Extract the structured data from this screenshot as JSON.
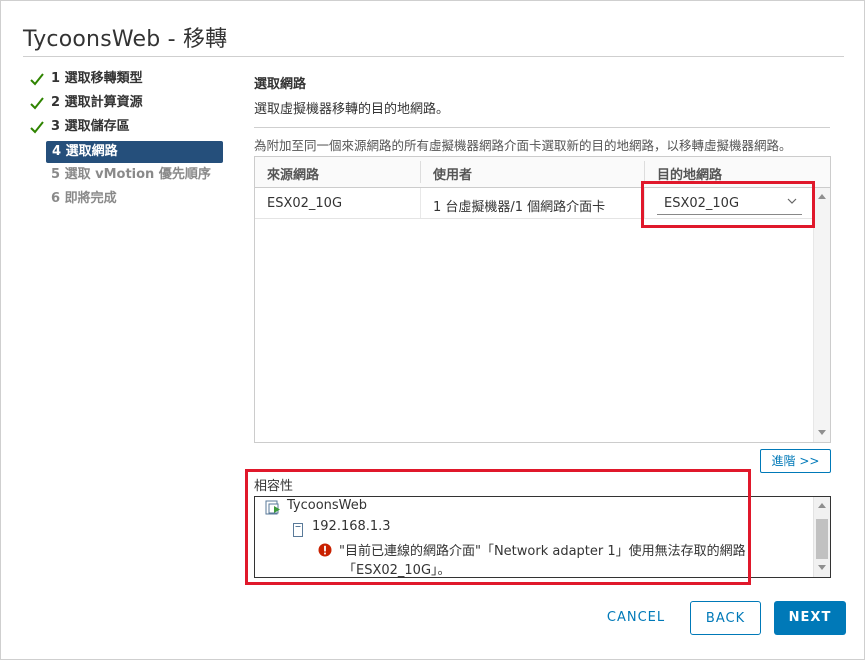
{
  "window": {
    "title": "TycoonsWeb - 移轉"
  },
  "steps": [
    {
      "label": "1 選取移轉類型",
      "state": "done"
    },
    {
      "label": "2 選取計算資源",
      "state": "done"
    },
    {
      "label": "3 選取儲存區",
      "state": "done"
    },
    {
      "label": "4 選取網路",
      "state": "active"
    },
    {
      "label": "5 選取 vMotion 優先順序",
      "state": "todo"
    },
    {
      "label": "6 即將完成",
      "state": "todo"
    }
  ],
  "main": {
    "heading": "選取網路",
    "subheading": "選取虛擬機器移轉的目的地網路。",
    "description": "為附加至同一個來源網路的所有虛擬機器網路介面卡選取新的目的地網路，以移轉虛擬機器網路。"
  },
  "grid": {
    "columns": [
      "來源網路",
      "使用者",
      "目的地網路"
    ],
    "rows": [
      {
        "source": "ESX02_10G",
        "users": "1 台虛擬機器/1 個網路介面卡",
        "destination": "ESX02_10G"
      }
    ]
  },
  "advanced_button": "進階 >>",
  "compatibility": {
    "label": "相容性",
    "vm": "TycoonsWeb",
    "host": "192.168.1.3",
    "error_line1": "\"目前已連線的網路介面\"「Network adapter 1」使用無法存取的網路",
    "error_line2": "「ESX02_10G」。"
  },
  "footer": {
    "cancel": "CANCEL",
    "back": "BACK",
    "next": "NEXT"
  },
  "colors": {
    "accent": "#0079b8",
    "active_step": "#254f7b",
    "highlight": "#e0182b",
    "error": "#c92100",
    "check": "#2f8400"
  }
}
